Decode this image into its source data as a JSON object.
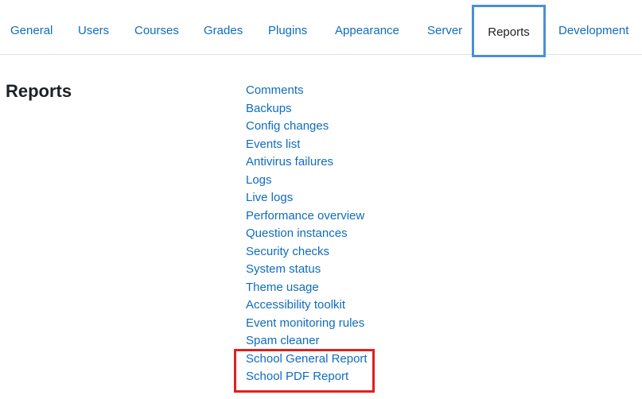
{
  "tabs": [
    {
      "label": "General"
    },
    {
      "label": "Users"
    },
    {
      "label": "Courses"
    },
    {
      "label": "Grades"
    },
    {
      "label": "Plugins"
    },
    {
      "label": "Appearance"
    },
    {
      "label": "Server"
    },
    {
      "label": "Reports",
      "active": true
    },
    {
      "label": "Development"
    }
  ],
  "section": {
    "title": "Reports"
  },
  "report_links": [
    "Comments",
    "Backups",
    "Config changes",
    "Events list",
    "Antivirus failures",
    "Logs",
    "Live logs",
    "Performance overview",
    "Question instances",
    "Security checks",
    "System status",
    "Theme usage",
    "Accessibility toolkit",
    "Event monitoring rules",
    "Spam cleaner",
    "School General Report",
    "School PDF Report"
  ],
  "colors": {
    "link": "#0f6cbf",
    "active_tab_border": "#4a8fd6",
    "highlight_box": "#e02020",
    "text": "#1d2125"
  }
}
